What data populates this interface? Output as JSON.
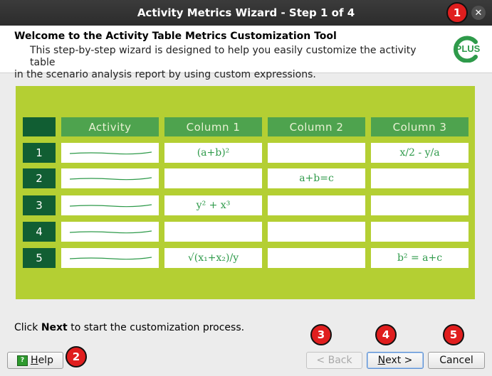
{
  "window": {
    "title": "Activity Metrics Wizard - Step 1 of 4",
    "close_glyph": "✕"
  },
  "header": {
    "title": "Welcome to the Activity Table Metrics Customization Tool",
    "desc_line1": "This step-by-step wizard is designed to help you easily customize the activity table",
    "desc_line2": "in the scenario analysis report by using custom expressions.",
    "logo_text": "PLUS",
    "logo_icon": "cplus-logo-icon",
    "logo_color": "#2e9a4a"
  },
  "table_image": {
    "background": "#b4cf33",
    "columns": [
      "Activity",
      "Column 1",
      "Column 2",
      "Column 3"
    ],
    "rows": [
      {
        "num": "1",
        "col1": "(a+b)²",
        "col2": "",
        "col3": "x/2 - y/a"
      },
      {
        "num": "2",
        "col1": "",
        "col2": "a+b=c",
        "col3": ""
      },
      {
        "num": "3",
        "col1": "y² + x³",
        "col2": "",
        "col3": ""
      },
      {
        "num": "4",
        "col1": "",
        "col2": "",
        "col3": ""
      },
      {
        "num": "5",
        "col1": "√(x₁+x₂)/y",
        "col2": "",
        "col3": "b² = a+c"
      }
    ]
  },
  "instruction": {
    "pre": "Click ",
    "bold": "Next",
    "post": " to start the customization process."
  },
  "buttons": {
    "help": "Help",
    "help_mnemonic": "H",
    "help_rest": "elp",
    "back": "< Back",
    "back_mnemonic": "B",
    "next_mnemonic": "N",
    "next_rest": "ext >",
    "cancel": "Cancel"
  },
  "badges": [
    "1",
    "2",
    "3",
    "4",
    "5"
  ],
  "colors": {
    "badge": "#e01e1e",
    "title_bar": "#2c2c2c",
    "header_green": "#4ea34e",
    "row_green": "#115e33"
  }
}
